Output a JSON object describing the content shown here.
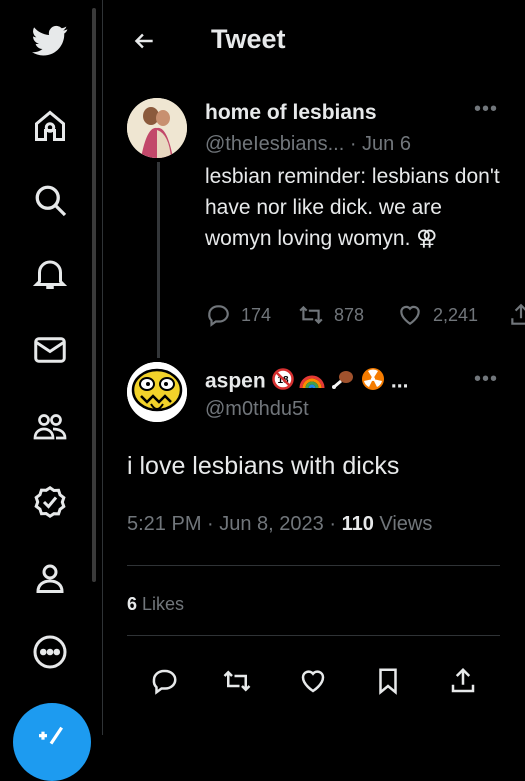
{
  "header": {
    "title": "Tweet"
  },
  "quoted_tweet": {
    "display_name": "home of lesbians",
    "handle": "@theIesbians...",
    "date": "· Jun 6",
    "text": "lesbian reminder: lesbians don't have nor like dick. we are womyn loving womyn. ⚢",
    "replies": "174",
    "retweets": "878",
    "likes": "2,241"
  },
  "main_tweet": {
    "display_name": "aspen",
    "name_suffix": "...",
    "handle": "@m0thdu5t",
    "text": "i love lesbians with dicks",
    "time": "5:21 PM · Jun 8, 2023 · ",
    "views_count": "110",
    "views_label": " Views",
    "likes_count": "6",
    "likes_label": " Likes"
  },
  "colors": {
    "accent": "#1d9bf0",
    "muted": "#71767b",
    "text": "#e7e9ea",
    "background": "#000000"
  },
  "icons": [
    "twitter-logo-icon",
    "home-icon",
    "search-icon",
    "bell-icon",
    "mail-icon",
    "communities-icon",
    "verified-icon",
    "profile-icon",
    "more-circle-icon",
    "compose-icon",
    "back-arrow-icon",
    "reply-icon",
    "retweet-icon",
    "like-icon",
    "bookmark-icon",
    "share-icon"
  ]
}
